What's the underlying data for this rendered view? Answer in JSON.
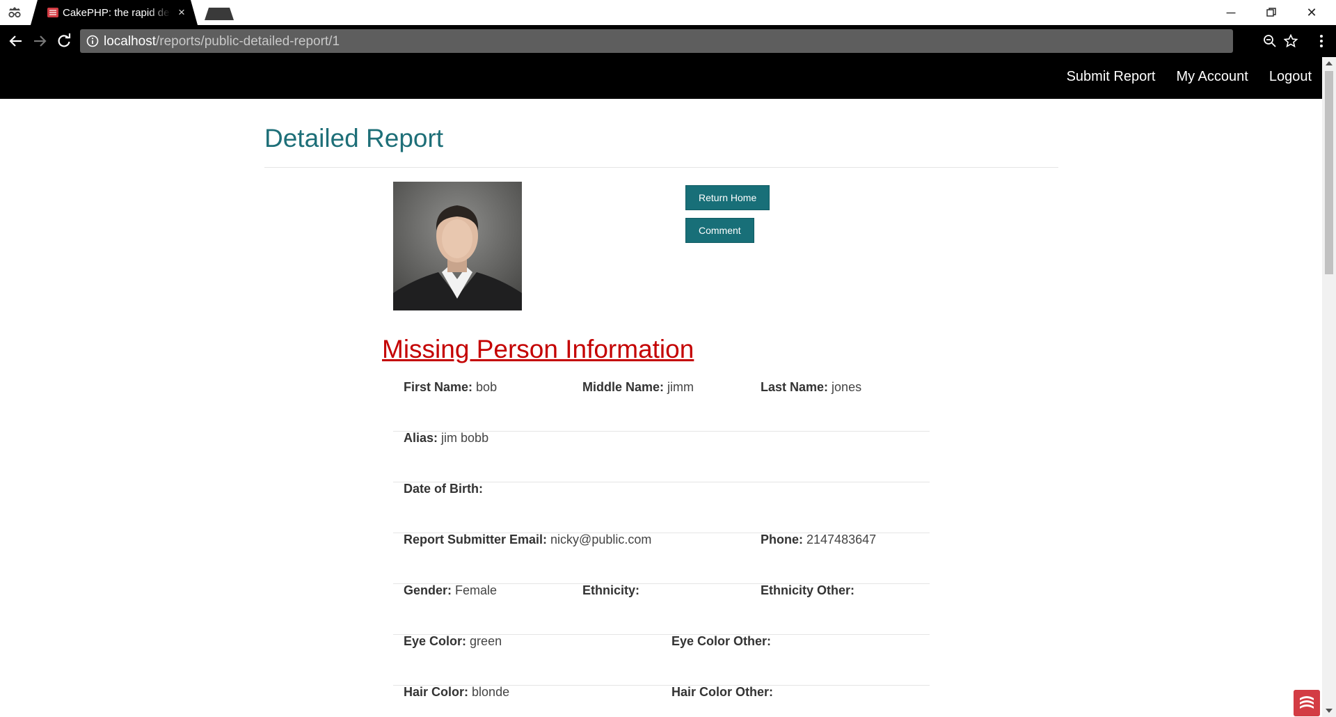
{
  "browser": {
    "tab_title": "CakePHP: the rapid development php framework",
    "url_host": "localhost",
    "url_path": "/reports/public-detailed-report/1"
  },
  "topnav": {
    "items": [
      {
        "label": "Submit Report"
      },
      {
        "label": "My Account"
      },
      {
        "label": "Logout"
      }
    ]
  },
  "page": {
    "title": "Detailed Report",
    "buttons": {
      "return_home": "Return Home",
      "comment": "Comment"
    },
    "section_title": "Missing Person Information",
    "fields": {
      "first_name": {
        "label": "First Name:",
        "value": "bob"
      },
      "middle_name": {
        "label": "Middle Name:",
        "value": "jimm"
      },
      "last_name": {
        "label": "Last Name:",
        "value": "jones"
      },
      "alias": {
        "label": "Alias:",
        "value": "jim bobb"
      },
      "dob": {
        "label": "Date of Birth:",
        "value": ""
      },
      "email": {
        "label": "Report Submitter Email:",
        "value": "nicky@public.com"
      },
      "phone": {
        "label": "Phone:",
        "value": "2147483647"
      },
      "gender": {
        "label": "Gender:",
        "value": "Female"
      },
      "ethnicity": {
        "label": "Ethnicity:",
        "value": ""
      },
      "ethnicity_other": {
        "label": "Ethnicity Other:",
        "value": ""
      },
      "eye_color": {
        "label": "Eye Color:",
        "value": "green"
      },
      "eye_color_other": {
        "label": "Eye Color Other:",
        "value": ""
      },
      "hair_color": {
        "label": "Hair Color:",
        "value": "blonde"
      },
      "hair_color_other": {
        "label": "Hair Color Other:",
        "value": ""
      }
    }
  },
  "colors": {
    "accent": "#186f78",
    "heading": "#1e6f78",
    "section": "#c40000"
  },
  "icons": [
    "incognito-icon",
    "cakephp-favicon",
    "close-icon",
    "back-icon",
    "forward-icon",
    "reload-icon",
    "info-icon",
    "zoom-icon",
    "star-icon",
    "menu-icon",
    "cakephp-badge-icon"
  ]
}
